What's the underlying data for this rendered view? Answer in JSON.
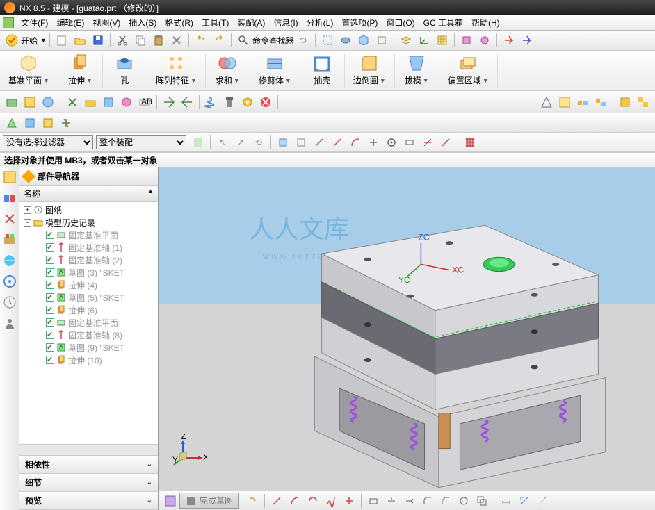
{
  "title": "NX 8.5 - 建模 - [guatao.prt （修改的）]",
  "menu": [
    "文件(F)",
    "编辑(E)",
    "视图(V)",
    "插入(S)",
    "格式(R)",
    "工具(T)",
    "装配(A)",
    "信息(I)",
    "分析(L)",
    "首选项(P)",
    "窗口(O)",
    "GC 工具箱",
    "帮助(H)"
  ],
  "start": "开始",
  "cmdFinder": "命令查找器",
  "ribbon": [
    {
      "label": "基准平面"
    },
    {
      "label": "拉伸"
    },
    {
      "label": "孔"
    },
    {
      "label": "阵列特征"
    },
    {
      "label": "求和"
    },
    {
      "label": "修剪体"
    },
    {
      "label": "抽壳"
    },
    {
      "label": "边倒圆"
    },
    {
      "label": "拔模"
    },
    {
      "label": "偏置区域"
    }
  ],
  "filter1": "没有选择过滤器",
  "filter2": "整个装配",
  "hint": "选择对象并使用 MB3，或者双击某一对象",
  "nav": {
    "title": "部件导航器",
    "col": "名称"
  },
  "tree": [
    {
      "l": 0,
      "exp": "+",
      "ic": "clock",
      "t": "图纸"
    },
    {
      "l": 0,
      "exp": "-",
      "ic": "folder",
      "t": "模型历史记录"
    },
    {
      "l": 1,
      "chk": 1,
      "ic": "plane",
      "t": "固定基准平面",
      "dim": 1
    },
    {
      "l": 1,
      "chk": 1,
      "ic": "axis",
      "t": "固定基准轴 (1)",
      "dim": 1
    },
    {
      "l": 1,
      "chk": 1,
      "ic": "axis",
      "t": "固定基准轴 (2)",
      "dim": 1
    },
    {
      "l": 1,
      "chk": 1,
      "ic": "sketch",
      "t": "草图 (3) \"SKET",
      "dim": 1
    },
    {
      "l": 1,
      "chk": 1,
      "ic": "ext",
      "t": "拉伸 (4)",
      "dim": 1
    },
    {
      "l": 1,
      "chk": 1,
      "ic": "sketch",
      "t": "草图 (5) \"SKET",
      "dim": 1
    },
    {
      "l": 1,
      "chk": 1,
      "ic": "ext",
      "t": "拉伸 (6)",
      "dim": 1
    },
    {
      "l": 1,
      "chk": 1,
      "ic": "plane",
      "t": "固定基准平面",
      "dim": 1
    },
    {
      "l": 1,
      "chk": 1,
      "ic": "axis",
      "t": "固定基准轴 (8)",
      "dim": 1
    },
    {
      "l": 1,
      "chk": 1,
      "ic": "sketch",
      "t": "草图 (9) \"SKET",
      "dim": 1
    },
    {
      "l": 1,
      "chk": 1,
      "ic": "ext",
      "t": "拉伸 (10)",
      "dim": 1
    }
  ],
  "panels": [
    "相依性",
    "细节",
    "预览"
  ],
  "finish": "完成草图",
  "axes": {
    "x": "XC",
    "y": "YC",
    "z": "ZC",
    "tx": "X",
    "ty": "Y",
    "tz": "Z"
  },
  "wm1": "人人文库",
  "wm2": "www.renrendoc.com"
}
